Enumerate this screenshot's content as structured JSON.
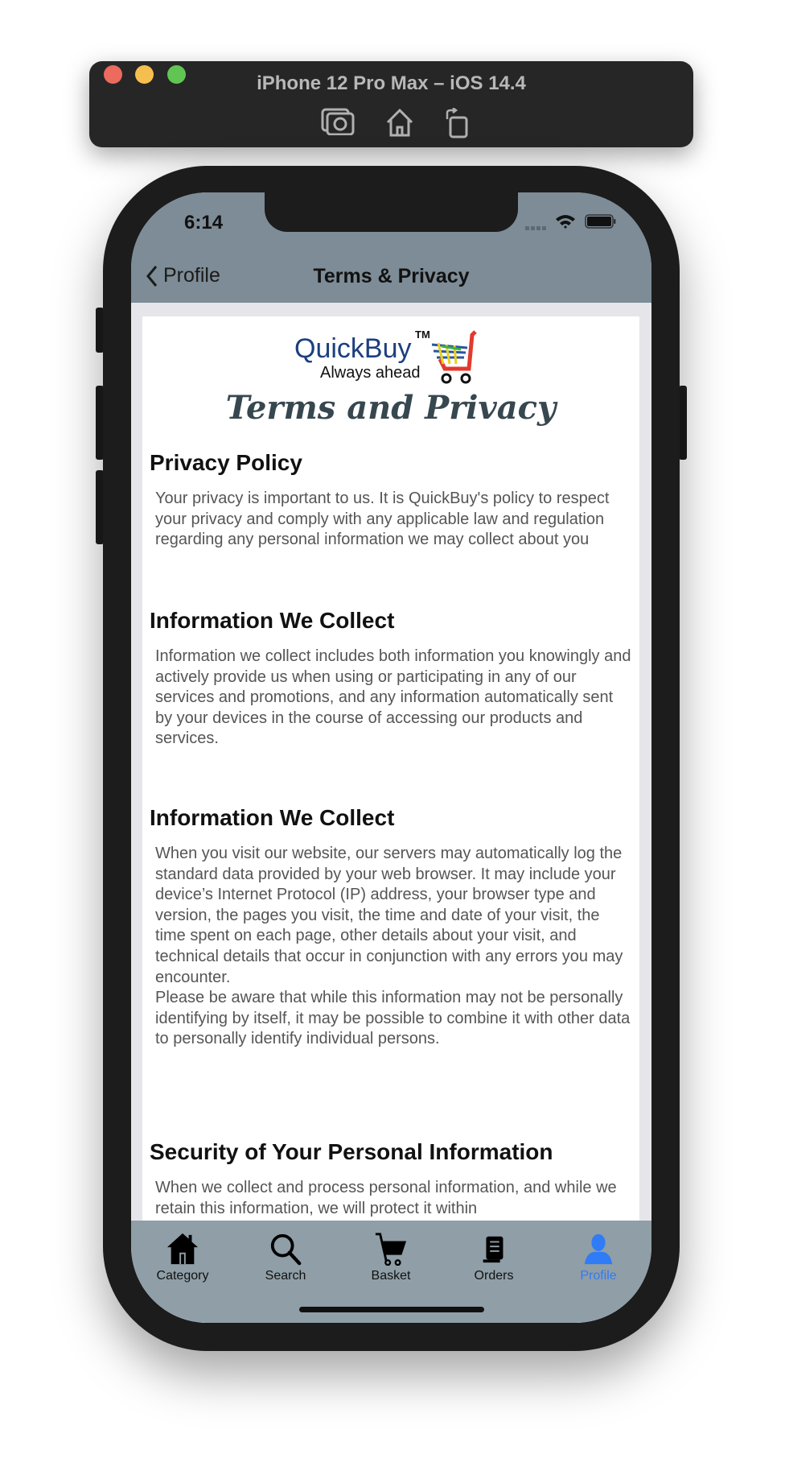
{
  "simulator": {
    "title": "iPhone 12 Pro Max – iOS 14.4",
    "icons": [
      "screenshot-icon",
      "home-icon",
      "rotate-icon"
    ],
    "lights": [
      "#ed6a5e",
      "#f5bf4f",
      "#61c554"
    ]
  },
  "status_bar": {
    "time": "6:14"
  },
  "nav": {
    "back_label": "Profile",
    "title": "Terms & Privacy",
    "bg": "#7d8c96"
  },
  "logo": {
    "brand": "QuickBuy",
    "tm": "TM",
    "tagline": "Always ahead"
  },
  "page_heading": "Terms and Privacy",
  "sections": [
    {
      "heading": "Privacy Policy",
      "body": "Your privacy is important to us. It is QuickBuy's policy to respect your privacy and comply with any applicable law and regulation regarding any personal information we may collect about you"
    },
    {
      "heading": "Information We Collect",
      "body": "Information we collect includes both information you knowingly and actively provide us when using or participating in any of our services and promotions, and any information automatically sent by your devices in the course of accessing our products and services."
    },
    {
      "heading": "Information We Collect",
      "body": "When you visit our website, our servers may automatically log the standard data provided by your web browser. It may include your device’s Internet Protocol (IP) address, your browser type and version, the pages you visit, the time and date of your visit, the time spent on each page, other details about your visit, and technical details that occur in conjunction with any errors you may encounter.\nPlease be aware that while this information may not be personally identifying by itself, it may be possible to combine it with other data to personally identify individual persons."
    },
    {
      "heading": "Security of Your Personal Information",
      "body": "When we collect and process personal information, and while we retain this information, we will protect it within"
    }
  ],
  "tabs": [
    {
      "label": "Category",
      "icon": "house-icon"
    },
    {
      "label": "Search",
      "icon": "search-icon"
    },
    {
      "label": "Basket",
      "icon": "cart-icon"
    },
    {
      "label": "Orders",
      "icon": "orders-icon"
    },
    {
      "label": "Profile",
      "icon": "person-icon",
      "active": true
    }
  ],
  "colors": {
    "active_tab": "#2f7cf6",
    "tabbar_bg": "#8f9ea7"
  }
}
